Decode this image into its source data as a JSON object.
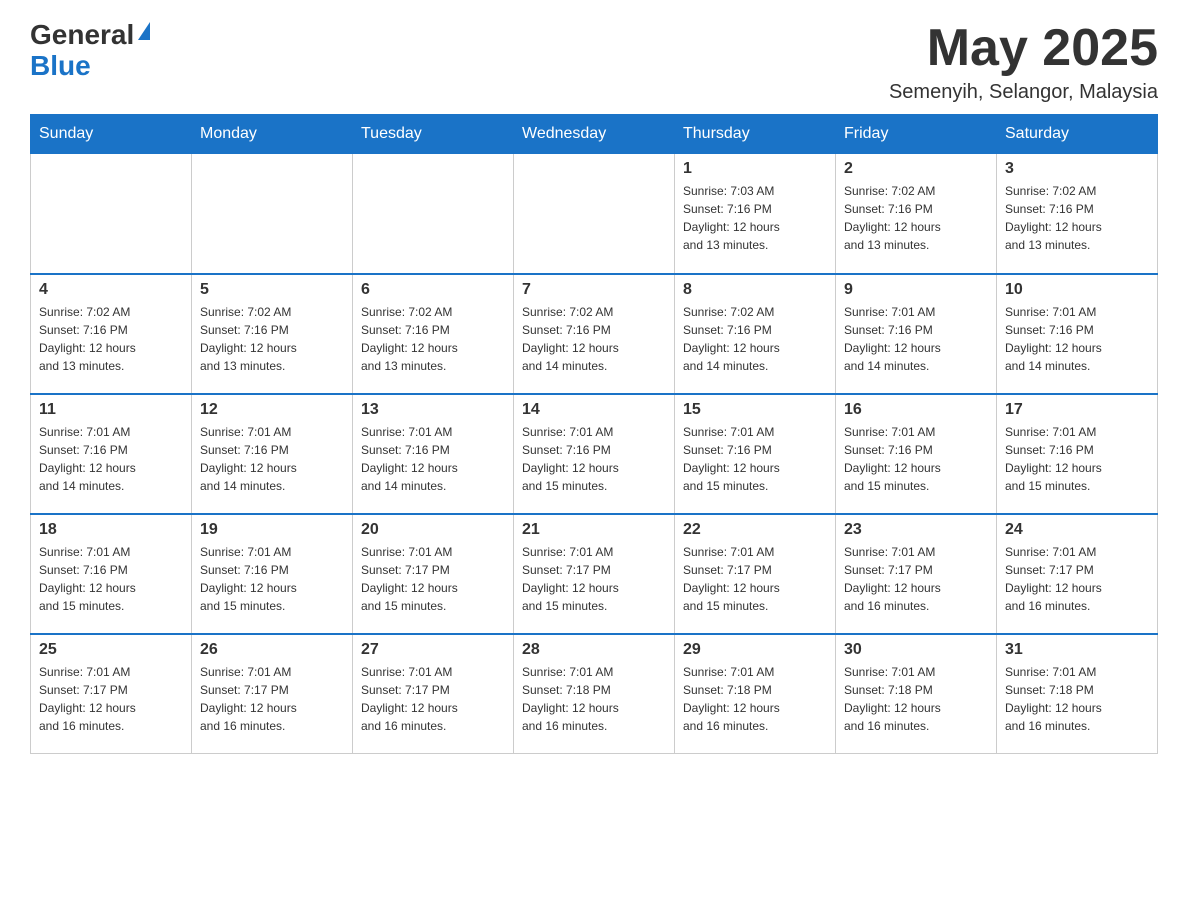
{
  "logo": {
    "general": "General",
    "blue": "Blue"
  },
  "title": {
    "month": "May 2025",
    "location": "Semenyih, Selangor, Malaysia"
  },
  "weekdays": [
    "Sunday",
    "Monday",
    "Tuesday",
    "Wednesday",
    "Thursday",
    "Friday",
    "Saturday"
  ],
  "weeks": [
    [
      {
        "day": "",
        "info": ""
      },
      {
        "day": "",
        "info": ""
      },
      {
        "day": "",
        "info": ""
      },
      {
        "day": "",
        "info": ""
      },
      {
        "day": "1",
        "info": "Sunrise: 7:03 AM\nSunset: 7:16 PM\nDaylight: 12 hours\nand 13 minutes."
      },
      {
        "day": "2",
        "info": "Sunrise: 7:02 AM\nSunset: 7:16 PM\nDaylight: 12 hours\nand 13 minutes."
      },
      {
        "day": "3",
        "info": "Sunrise: 7:02 AM\nSunset: 7:16 PM\nDaylight: 12 hours\nand 13 minutes."
      }
    ],
    [
      {
        "day": "4",
        "info": "Sunrise: 7:02 AM\nSunset: 7:16 PM\nDaylight: 12 hours\nand 13 minutes."
      },
      {
        "day": "5",
        "info": "Sunrise: 7:02 AM\nSunset: 7:16 PM\nDaylight: 12 hours\nand 13 minutes."
      },
      {
        "day": "6",
        "info": "Sunrise: 7:02 AM\nSunset: 7:16 PM\nDaylight: 12 hours\nand 13 minutes."
      },
      {
        "day": "7",
        "info": "Sunrise: 7:02 AM\nSunset: 7:16 PM\nDaylight: 12 hours\nand 14 minutes."
      },
      {
        "day": "8",
        "info": "Sunrise: 7:02 AM\nSunset: 7:16 PM\nDaylight: 12 hours\nand 14 minutes."
      },
      {
        "day": "9",
        "info": "Sunrise: 7:01 AM\nSunset: 7:16 PM\nDaylight: 12 hours\nand 14 minutes."
      },
      {
        "day": "10",
        "info": "Sunrise: 7:01 AM\nSunset: 7:16 PM\nDaylight: 12 hours\nand 14 minutes."
      }
    ],
    [
      {
        "day": "11",
        "info": "Sunrise: 7:01 AM\nSunset: 7:16 PM\nDaylight: 12 hours\nand 14 minutes."
      },
      {
        "day": "12",
        "info": "Sunrise: 7:01 AM\nSunset: 7:16 PM\nDaylight: 12 hours\nand 14 minutes."
      },
      {
        "day": "13",
        "info": "Sunrise: 7:01 AM\nSunset: 7:16 PM\nDaylight: 12 hours\nand 14 minutes."
      },
      {
        "day": "14",
        "info": "Sunrise: 7:01 AM\nSunset: 7:16 PM\nDaylight: 12 hours\nand 15 minutes."
      },
      {
        "day": "15",
        "info": "Sunrise: 7:01 AM\nSunset: 7:16 PM\nDaylight: 12 hours\nand 15 minutes."
      },
      {
        "day": "16",
        "info": "Sunrise: 7:01 AM\nSunset: 7:16 PM\nDaylight: 12 hours\nand 15 minutes."
      },
      {
        "day": "17",
        "info": "Sunrise: 7:01 AM\nSunset: 7:16 PM\nDaylight: 12 hours\nand 15 minutes."
      }
    ],
    [
      {
        "day": "18",
        "info": "Sunrise: 7:01 AM\nSunset: 7:16 PM\nDaylight: 12 hours\nand 15 minutes."
      },
      {
        "day": "19",
        "info": "Sunrise: 7:01 AM\nSunset: 7:16 PM\nDaylight: 12 hours\nand 15 minutes."
      },
      {
        "day": "20",
        "info": "Sunrise: 7:01 AM\nSunset: 7:17 PM\nDaylight: 12 hours\nand 15 minutes."
      },
      {
        "day": "21",
        "info": "Sunrise: 7:01 AM\nSunset: 7:17 PM\nDaylight: 12 hours\nand 15 minutes."
      },
      {
        "day": "22",
        "info": "Sunrise: 7:01 AM\nSunset: 7:17 PM\nDaylight: 12 hours\nand 15 minutes."
      },
      {
        "day": "23",
        "info": "Sunrise: 7:01 AM\nSunset: 7:17 PM\nDaylight: 12 hours\nand 16 minutes."
      },
      {
        "day": "24",
        "info": "Sunrise: 7:01 AM\nSunset: 7:17 PM\nDaylight: 12 hours\nand 16 minutes."
      }
    ],
    [
      {
        "day": "25",
        "info": "Sunrise: 7:01 AM\nSunset: 7:17 PM\nDaylight: 12 hours\nand 16 minutes."
      },
      {
        "day": "26",
        "info": "Sunrise: 7:01 AM\nSunset: 7:17 PM\nDaylight: 12 hours\nand 16 minutes."
      },
      {
        "day": "27",
        "info": "Sunrise: 7:01 AM\nSunset: 7:17 PM\nDaylight: 12 hours\nand 16 minutes."
      },
      {
        "day": "28",
        "info": "Sunrise: 7:01 AM\nSunset: 7:18 PM\nDaylight: 12 hours\nand 16 minutes."
      },
      {
        "day": "29",
        "info": "Sunrise: 7:01 AM\nSunset: 7:18 PM\nDaylight: 12 hours\nand 16 minutes."
      },
      {
        "day": "30",
        "info": "Sunrise: 7:01 AM\nSunset: 7:18 PM\nDaylight: 12 hours\nand 16 minutes."
      },
      {
        "day": "31",
        "info": "Sunrise: 7:01 AM\nSunset: 7:18 PM\nDaylight: 12 hours\nand 16 minutes."
      }
    ]
  ]
}
